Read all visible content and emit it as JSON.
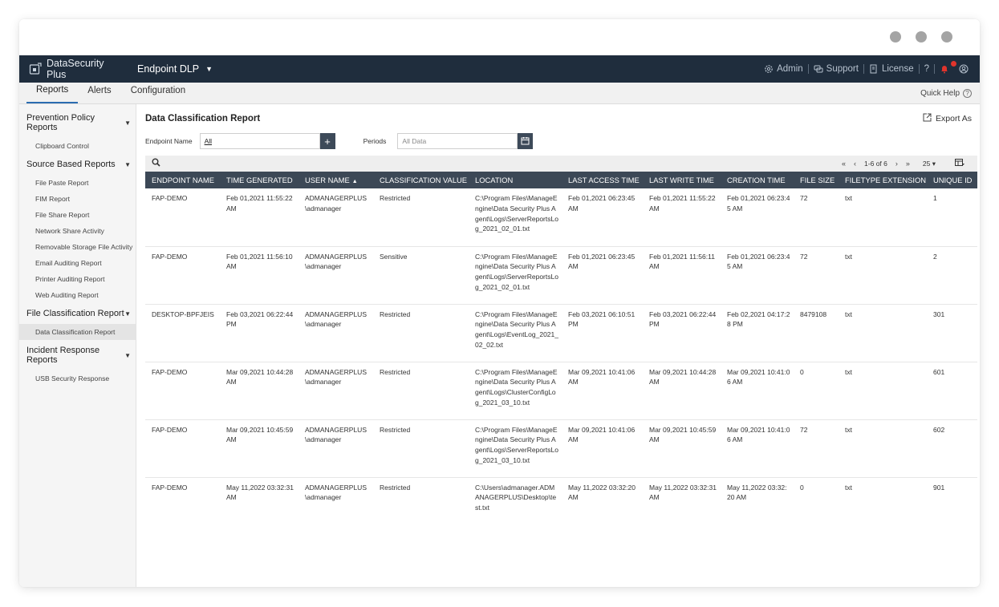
{
  "app": {
    "brand": "DataSecurity Plus",
    "product": "Endpoint DLP",
    "top_links": {
      "admin": "Admin",
      "support": "Support",
      "license": "License",
      "help": "?"
    }
  },
  "tabs": [
    "Reports",
    "Alerts",
    "Configuration"
  ],
  "quick_help": "Quick Help",
  "sidebar": {
    "groups": [
      {
        "label": "Prevention Policy Reports",
        "items": [
          "Clipboard Control"
        ]
      },
      {
        "label": "Source Based Reports",
        "items": [
          "File Paste Report",
          "FIM Report",
          "File Share Report",
          "Network Share Activity",
          "Removable Storage File Activity",
          "Email Auditing Report",
          "Printer Auditing Report",
          "Web Auditing Report"
        ]
      },
      {
        "label": "File Classification Report",
        "items": [
          "Data Classification Report"
        ]
      },
      {
        "label": "Incident Response Reports",
        "items": [
          "USB Security Response"
        ]
      }
    ],
    "active_item": "Data Classification Report"
  },
  "main": {
    "title": "Data Classification Report",
    "export_label": "Export As",
    "filters": {
      "endpoint_label": "Endpoint Name",
      "endpoint_value": "All",
      "periods_label": "Periods",
      "periods_placeholder": "All Data"
    },
    "pager": {
      "range": "1-6 of 6",
      "page_size": "25"
    }
  },
  "table": {
    "columns": [
      "ENDPOINT NAME",
      "TIME GENERATED",
      "USER NAME",
      "CLASSIFICATION VALUE",
      "LOCATION",
      "LAST ACCESS TIME",
      "LAST WRITE TIME",
      "CREATION TIME",
      "FILE SIZE",
      "FILETYPE EXTENSION",
      "UNIQUE ID"
    ],
    "rows": [
      [
        "FAP-DEMO",
        "Feb 01,2021 11:55:22 AM",
        "ADMANAGERPLUS \\admanager",
        "Restricted",
        "C:\\Program Files\\ManageEngine\\Data Security Plus Agent\\Logs\\ServerReportsLog_2021_02_01.txt",
        "Feb 01,2021 06:23:45 AM",
        "Feb 01,2021 11:55:22 AM",
        "Feb 01,2021 06:23:45 AM",
        "72",
        "txt",
        "1"
      ],
      [
        "FAP-DEMO",
        "Feb 01,2021 11:56:10 AM",
        "ADMANAGERPLUS \\admanager",
        "Sensitive",
        "C:\\Program Files\\ManageEngine\\Data Security Plus Agent\\Logs\\ServerReportsLog_2021_02_01.txt",
        "Feb 01,2021 06:23:45 AM",
        "Feb 01,2021 11:56:11 AM",
        "Feb 01,2021 06:23:45 AM",
        "72",
        "txt",
        "2"
      ],
      [
        "DESKTOP-BPFJEIS",
        "Feb 03,2021 06:22:44 PM",
        "ADMANAGERPLUS \\admanager",
        "Restricted",
        "C:\\Program Files\\ManageEngine\\Data Security Plus Agent\\Logs\\EventLog_2021_02_02.txt",
        "Feb 03,2021 06:10:51 PM",
        "Feb 03,2021 06:22:44 PM",
        "Feb 02,2021 04:17:28 PM",
        "8479108",
        "txt",
        "301"
      ],
      [
        "FAP-DEMO",
        "Mar 09,2021 10:44:28 AM",
        "ADMANAGERPLUS \\admanager",
        "Restricted",
        "C:\\Program Files\\ManageEngine\\Data Security Plus Agent\\Logs\\ClusterConfigLog_2021_03_10.txt",
        "Mar 09,2021 10:41:06 AM",
        "Mar 09,2021 10:44:28 AM",
        "Mar 09,2021 10:41:06 AM",
        "0",
        "txt",
        "601"
      ],
      [
        "FAP-DEMO",
        "Mar 09,2021 10:45:59 AM",
        "ADMANAGERPLUS \\admanager",
        "Restricted",
        "C:\\Program Files\\ManageEngine\\Data Security Plus Agent\\Logs\\ServerReportsLog_2021_03_10.txt",
        "Mar 09,2021 10:41:06 AM",
        "Mar 09,2021 10:45:59 AM",
        "Mar 09,2021 10:41:06 AM",
        "72",
        "txt",
        "602"
      ],
      [
        "FAP-DEMO",
        "May 11,2022 03:32:31 AM",
        "ADMANAGERPLUS \\admanager",
        "Restricted",
        "C:\\Users\\admanager.ADMANAGERPLUS\\Desktop\\test.txt",
        "May 11,2022 03:32:20 AM",
        "May 11,2022 03:32:31 AM",
        "May 11,2022 03:32:20 AM",
        "0",
        "txt",
        "901"
      ]
    ]
  },
  "colors": {
    "topbar": "#1f2d3d",
    "table_header": "#3c4856",
    "active_tab": "#2b6cb0",
    "badge": "#e0342c"
  }
}
